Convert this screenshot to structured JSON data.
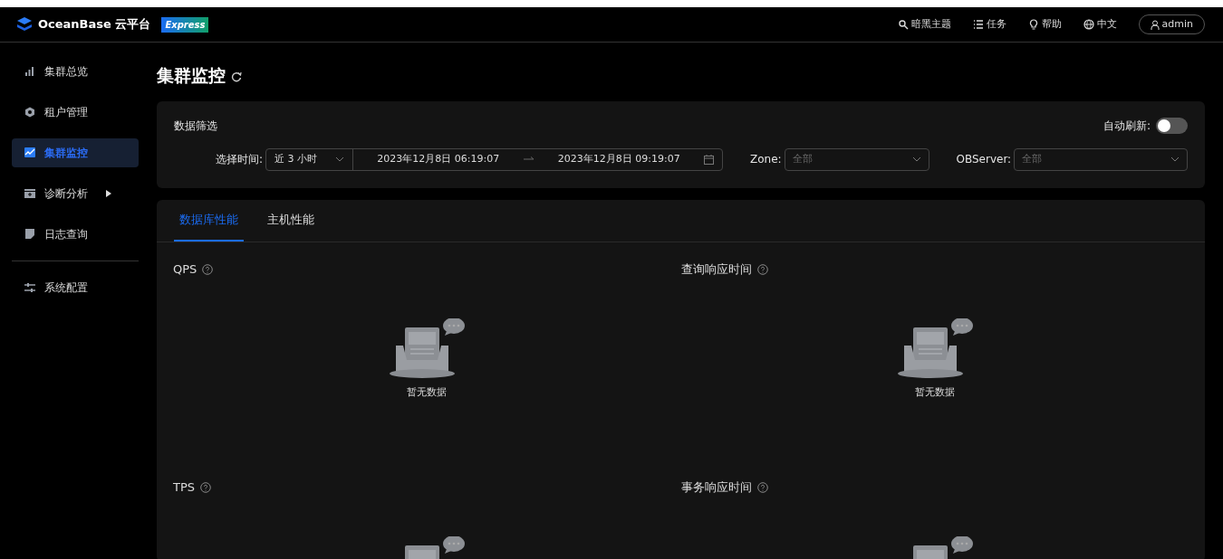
{
  "header": {
    "brand": "OceanBase 云平台",
    "edition": "Express",
    "actions": [
      {
        "kind": "theme",
        "label": "暗黑主题"
      },
      {
        "kind": "tasks",
        "label": "任务"
      },
      {
        "kind": "help",
        "label": "帮助"
      },
      {
        "kind": "language",
        "label": "中文"
      }
    ],
    "user": "admin"
  },
  "sidebar": {
    "items": [
      {
        "label": "集群总览",
        "selected": false
      },
      {
        "label": "租户管理",
        "selected": false
      },
      {
        "label": "集群监控",
        "selected": true
      },
      {
        "label": "诊断分析",
        "selected": false,
        "has_submenu": true
      },
      {
        "label": "日志查询",
        "selected": false
      },
      {
        "label": "系统配置",
        "selected": false,
        "divider_before": true
      }
    ]
  },
  "page": {
    "title": "集群监控"
  },
  "filter": {
    "title": "数据筛选",
    "auto_refresh_label": "自动刷新:",
    "auto_refresh_on": false,
    "time_label": "选择时间:",
    "range_preset": "近 3 小时",
    "start": "2023年12月8日 06:19:07",
    "end": "2023年12月8日 09:19:07",
    "zone_label": "Zone:",
    "zone_placeholder": "全部",
    "server_label": "OBServer:",
    "server_placeholder": "全部"
  },
  "tabs": [
    {
      "label": "数据库性能",
      "selected": true
    },
    {
      "label": "主机性能",
      "selected": false
    }
  ],
  "panels": [
    {
      "title": "QPS",
      "empty_text": "暂无数据"
    },
    {
      "title": "查询响应时间",
      "empty_text": "暂无数据"
    },
    {
      "title": "TPS"
    },
    {
      "title": "事务响应时间"
    }
  ]
}
